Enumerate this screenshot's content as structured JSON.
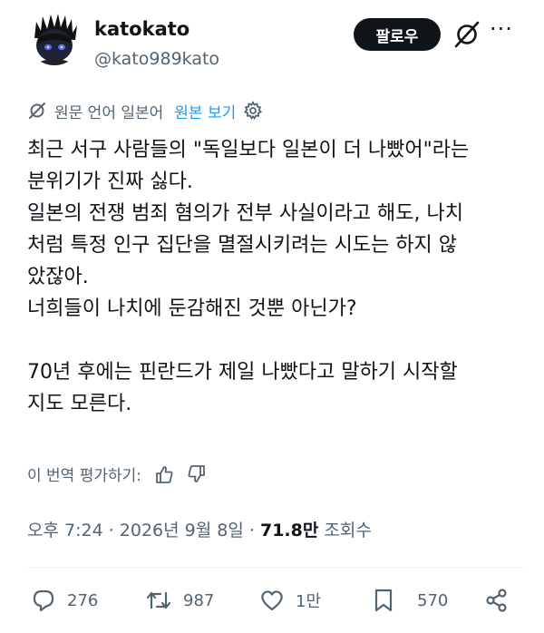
{
  "author": {
    "name": "katokato",
    "handle": "@kato989kato"
  },
  "header": {
    "follow_label": "팔로우",
    "more_label": "···"
  },
  "translation": {
    "source_label": "원문 언어 일본어",
    "show_original_label": "원본 보기"
  },
  "post": {
    "text": "최근 서구 사람들의 \"독일보다 일본이 더 나빴어\"라는\n분위기가 진짜 싫다.\n일본의 전쟁 범죄 혐의가 전부 사실이라고 해도, 나치\n처럼 특정 인구 집단을 멸절시키려는 시도는 하지 않\n았잖아.\n너희들이 나치에 둔감해진 것뿐 아닌가?\n\n70년 후에는 핀란드가 제일 나빴다고 말하기 시작할\n지도 모른다."
  },
  "rating": {
    "label": "이 번역 평가하기:"
  },
  "meta": {
    "time": "오후 7:24",
    "sep1": " · ",
    "date": "2026년 9월 8일",
    "sep2": " · ",
    "views_count": "71.8만",
    "views_label": " 조회수"
  },
  "actions": {
    "replies": "276",
    "reposts": "987",
    "likes": "1만",
    "bookmarks": "570"
  }
}
